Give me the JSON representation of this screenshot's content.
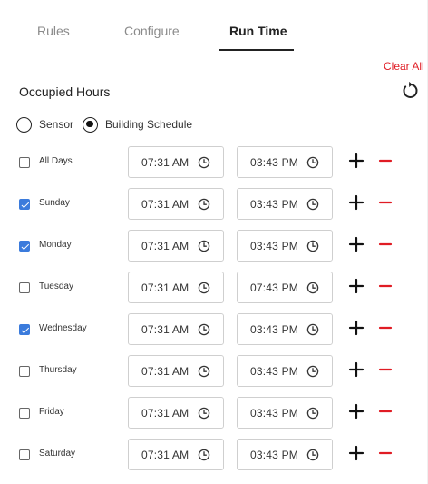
{
  "tabs": [
    {
      "label": "Rules",
      "active": false
    },
    {
      "label": "Configure",
      "active": false
    },
    {
      "label": "Run Time",
      "active": true
    }
  ],
  "clear_all_label": "Clear All",
  "section_title": "Occupied Hours",
  "radio_options": [
    {
      "label": "Sensor",
      "checked": false
    },
    {
      "label": "Building Schedule",
      "checked": true
    }
  ],
  "days": [
    {
      "label": "All Days",
      "checked": false,
      "start": "07:31  AM",
      "end": "03:43  PM"
    },
    {
      "label": "Sunday",
      "checked": true,
      "start": "07:31  AM",
      "end": "03:43  PM"
    },
    {
      "label": "Monday",
      "checked": true,
      "start": "07:31  AM",
      "end": "03:43  PM"
    },
    {
      "label": "Tuesday",
      "checked": false,
      "start": "07:31  AM",
      "end": "07:43  PM"
    },
    {
      "label": "Wednesday",
      "checked": true,
      "start": "07:31  AM",
      "end": "03:43  PM"
    },
    {
      "label": "Thursday",
      "checked": false,
      "start": "07:31  AM",
      "end": "03:43  PM"
    },
    {
      "label": "Friday",
      "checked": false,
      "start": "07:31  AM",
      "end": "03:43  PM"
    },
    {
      "label": "Saturday",
      "checked": false,
      "start": "07:31  AM",
      "end": "03:43  PM"
    }
  ],
  "colors": {
    "accent_red": "#e01c24",
    "checkbox_blue": "#3b7bdc",
    "active_tab": "#222222",
    "inactive_tab": "#8a8a8a"
  },
  "icons": {
    "reset": "refresh-icon",
    "clock": "clock-icon",
    "add": "plus-icon",
    "remove": "minus-icon"
  }
}
